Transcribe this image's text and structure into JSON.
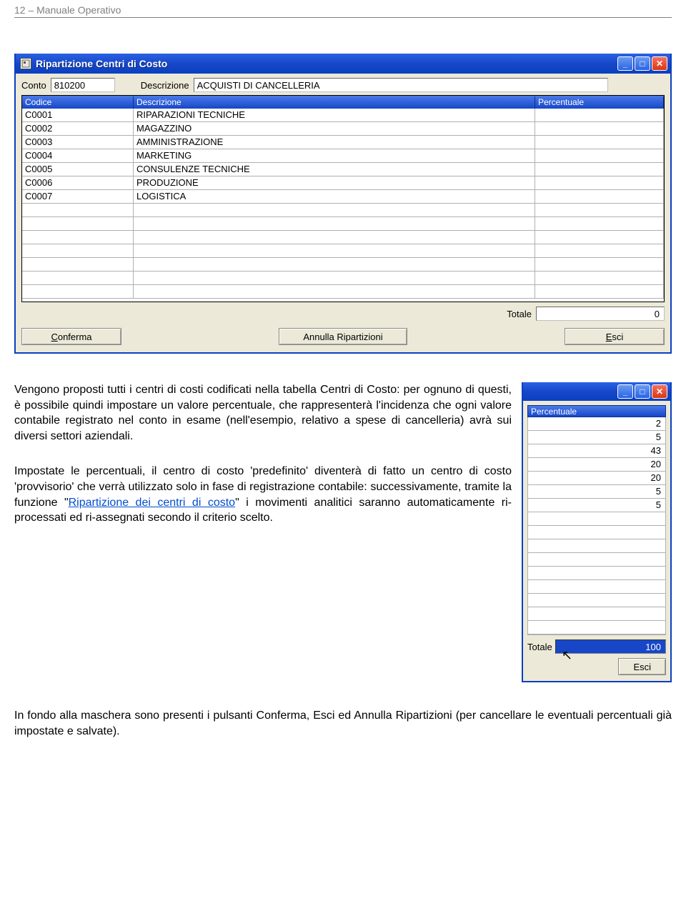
{
  "page_header": "12 –  Manuale Operativo",
  "window": {
    "title": "Ripartizione Centri di Costo",
    "fields": {
      "conto_label": "Conto",
      "conto_value": "810200",
      "desc_label": "Descrizione",
      "desc_value": "ACQUISTI DI CANCELLERIA"
    },
    "columns": {
      "codice": "Codice",
      "descrizione": "Descrizione",
      "percentuale": "Percentuale"
    },
    "rows": [
      {
        "codice": "C0001",
        "descrizione": "RIPARAZIONI TECNICHE",
        "percentuale": ""
      },
      {
        "codice": "C0002",
        "descrizione": "MAGAZZINO",
        "percentuale": ""
      },
      {
        "codice": "C0003",
        "descrizione": "AMMINISTRAZIONE",
        "percentuale": ""
      },
      {
        "codice": "C0004",
        "descrizione": "MARKETING",
        "percentuale": ""
      },
      {
        "codice": "C0005",
        "descrizione": "CONSULENZE TECNICHE",
        "percentuale": ""
      },
      {
        "codice": "C0006",
        "descrizione": "PRODUZIONE",
        "percentuale": ""
      },
      {
        "codice": "C0007",
        "descrizione": "LOGISTICA",
        "percentuale": ""
      }
    ],
    "empty_rows": 7,
    "totale_label": "Totale",
    "totale_value": "0",
    "buttons": {
      "conferma_pre": "C",
      "conferma": "onferma",
      "annulla": "Annulla Ripartizioni",
      "esci_pre": "E",
      "esci": "sci"
    }
  },
  "paragraphs": {
    "p1": "Vengono proposti tutti i centri di costi codificati nella tabella Centri di Costo: per ognuno di questi, è possibile quindi impostare un valore percentuale, che rappresenterà l'incidenza che ogni valore contabile registrato nel conto in esame (nell'esempio, relativo a spese di cancelleria) avrà sui diversi settori aziendali.",
    "p2_a": "Impostate le percentuali, il centro di costo 'predefinito' diventerà di fatto un centro di costo 'provvisorio' che verrà utilizzato solo in fase di registrazione contabile: successivamente, tramite la funzione \"",
    "p2_link": "Ripartizione dei centri di costo",
    "p2_b": "\" i movimenti analitici saranno automaticamente ri-processati ed ri-assegnati secondo il criterio scelto.",
    "p3": "In fondo alla maschera sono presenti i pulsanti Conferma, Esci ed Annulla Ripartizioni (per cancellare le eventuali percentuali già impostate e salvate)."
  },
  "window2": {
    "column": "Percentuale",
    "values": [
      "2",
      "5",
      "43",
      "20",
      "20",
      "5",
      "5"
    ],
    "empty_rows": 9,
    "totale_label": "Totale",
    "totale_value": "100",
    "esci_pre": "E",
    "esci": "sci"
  }
}
